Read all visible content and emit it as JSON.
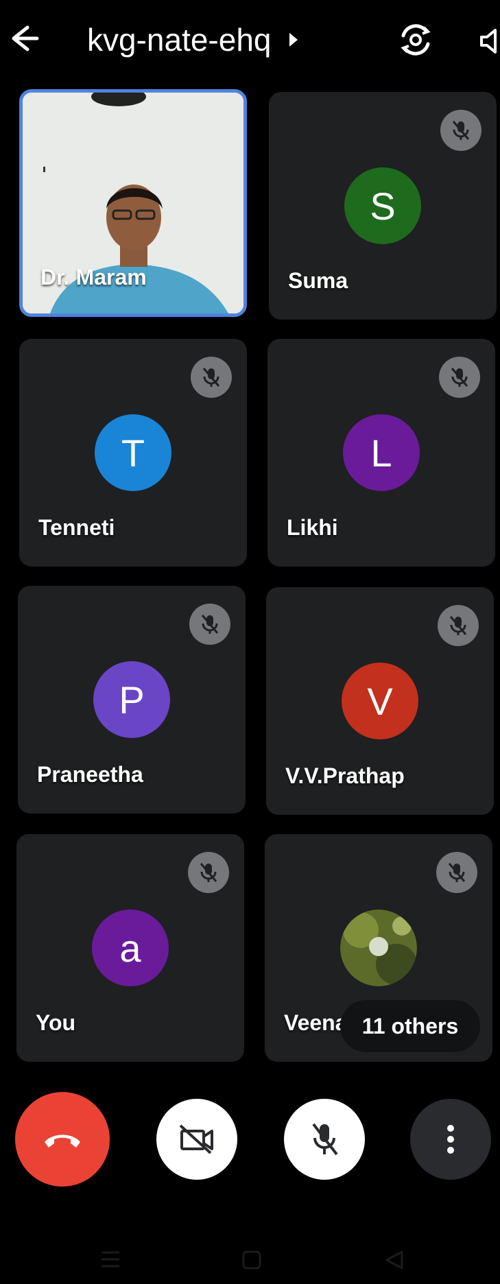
{
  "header": {
    "meeting_code": "kvg-nate-ehq",
    "icons": {
      "back": "arrow-back-icon",
      "caret": "caret-right-icon",
      "flip_camera": "flip-camera-icon",
      "speaker": "speaker-icon"
    }
  },
  "participants": [
    {
      "name": "Dr. Maram",
      "type": "video",
      "muted": false
    },
    {
      "name": "Suma",
      "initial": "S",
      "color": "#1e6b1e",
      "muted": true
    },
    {
      "name": "Tenneti",
      "initial": "T",
      "color": "#1a84d6",
      "muted": true
    },
    {
      "name": "Likhi",
      "initial": "L",
      "color": "#6a1b9a",
      "muted": true
    },
    {
      "name": "Praneetha",
      "initial": "P",
      "color": "#6a45c6",
      "muted": true
    },
    {
      "name": "V.V.Prathap",
      "initial": "V",
      "color": "#c3301d",
      "muted": true
    },
    {
      "name": "You",
      "initial": "a",
      "color": "#6a1b9a",
      "muted": true
    },
    {
      "name": "Veena",
      "type": "photo",
      "muted": true
    }
  ],
  "overflow": {
    "label": "11 others"
  },
  "controls": {
    "hang_up": "hang-up-icon",
    "camera": "camera-off-icon",
    "mic": "mic-off-icon",
    "more": "more-vert-icon",
    "colors": {
      "hang_up": "#ea4335",
      "camera": "#ffffff",
      "mic": "#ffffff",
      "more": "#2a2b2e"
    }
  },
  "navbar": {
    "icons": [
      "menu-icon",
      "home-square-icon",
      "back-triangle-icon"
    ]
  }
}
